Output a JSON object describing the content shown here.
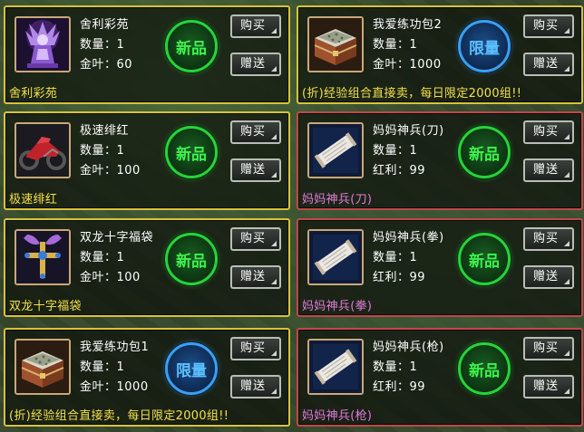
{
  "labels": {
    "qty": "数量：1",
    "buy": "购买",
    "gift": "赠送",
    "badge_new": "新品",
    "badge_limit": "限量"
  },
  "colors": {
    "frame_gold": "#d8c23a",
    "frame_red": "#c0484a",
    "footer_gold": "#f2e04a",
    "footer_pink": "#e07ad8",
    "badge_new": "#27d33a",
    "badge_limit": "#3aa0f0"
  },
  "items": [
    {
      "name": "舍利彩苑",
      "qty": "数量：1",
      "price": "金叶：60",
      "footer": "舍利彩苑",
      "badge": "新品",
      "frame": "gold",
      "icon": "purple-statue-icon"
    },
    {
      "name": "我爱练功包2",
      "qty": "数量：1",
      "price": "金叶：1000",
      "footer": "(折)经验组合直接卖，每日限定2000组!!",
      "badge": "限量",
      "frame": "gold",
      "icon": "treasure-chest-icon"
    },
    {
      "name": "极速绯红",
      "qty": "数量：1",
      "price": "金叶：100",
      "footer": "极速绯红",
      "badge": "新品",
      "frame": "gold",
      "icon": "red-motorcycle-icon"
    },
    {
      "name": "妈妈神兵(刀)",
      "qty": "数量：1",
      "price": "红利：99",
      "footer": "妈妈神兵(刀)",
      "badge": "新品",
      "frame": "red",
      "icon": "scroll-icon"
    },
    {
      "name": "双龙十字福袋",
      "qty": "数量：1",
      "price": "金叶：100",
      "footer": "双龙十字福袋",
      "badge": "新品",
      "frame": "gold",
      "icon": "dragon-cross-icon"
    },
    {
      "name": "妈妈神兵(拳)",
      "qty": "数量：1",
      "price": "红利：99",
      "footer": "妈妈神兵(拳)",
      "badge": "新品",
      "frame": "red",
      "icon": "scroll-icon"
    },
    {
      "name": "我爱练功包1",
      "qty": "数量：1",
      "price": "金叶：1000",
      "footer": "(折)经验组合直接卖，每日限定2000组!!",
      "badge": "限量",
      "frame": "gold",
      "icon": "treasure-chest-icon"
    },
    {
      "name": "妈妈神兵(枪)",
      "qty": "数量：1",
      "price": "红利：99",
      "footer": "妈妈神兵(枪)",
      "badge": "新品",
      "frame": "red",
      "icon": "scroll-icon"
    }
  ]
}
